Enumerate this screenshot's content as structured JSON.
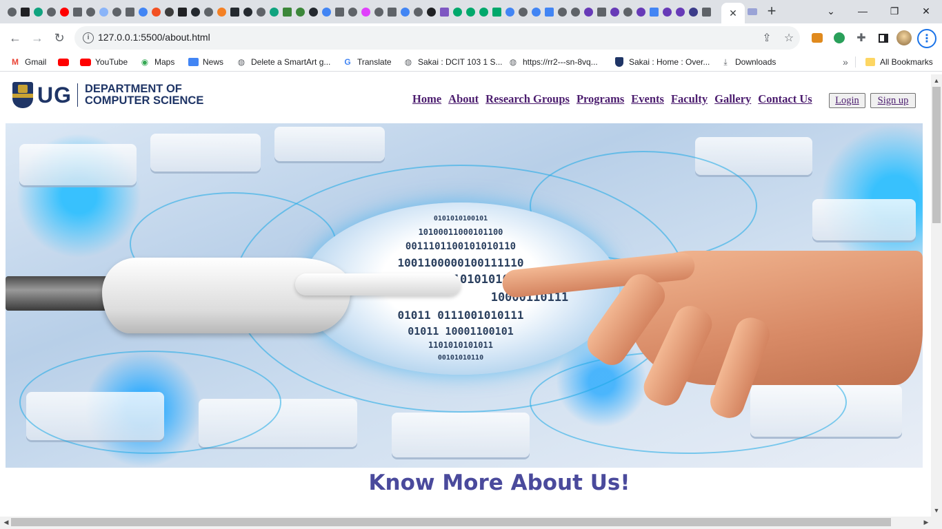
{
  "browser": {
    "url": "127.0.0.1:5500/about.html",
    "tab_close": "✕",
    "new_tab": "+",
    "window_controls": {
      "minimize": "—",
      "maximize": "❐",
      "close": "✕",
      "tab_search": "⌄"
    },
    "nav_icons": {
      "back": "←",
      "forward": "→",
      "reload": "↻"
    },
    "bookmarks": [
      {
        "label": "Gmail",
        "icon": "gmail-icon"
      },
      {
        "label": "",
        "icon": "youtube-icon"
      },
      {
        "label": "YouTube",
        "icon": "youtube-icon"
      },
      {
        "label": "Maps",
        "icon": "maps-icon"
      },
      {
        "label": "News",
        "icon": "news-icon"
      },
      {
        "label": "Delete a SmartArt g...",
        "icon": "globe-icon"
      },
      {
        "label": "Translate",
        "icon": "translate-icon"
      },
      {
        "label": "Sakai : DCIT 103 1 S...",
        "icon": "globe-icon"
      },
      {
        "label": "https://rr2---sn-8vq...",
        "icon": "globe-icon"
      },
      {
        "label": "Sakai : Home : Over...",
        "icon": "ug-crest-icon"
      },
      {
        "label": "Downloads",
        "icon": "download-icon"
      }
    ],
    "bookmarks_overflow": "»",
    "all_bookmarks": "All Bookmarks"
  },
  "site": {
    "logo_text": "UG",
    "dept_line1": "DEPARTMENT OF",
    "dept_line2": "COMPUTER SCIENCE",
    "nav": [
      "Home",
      "About",
      "Research Groups",
      "Programs",
      "Events",
      "Faculty",
      "Gallery",
      "Contact Us"
    ],
    "login_label": "Login",
    "signup_label": "Sign up",
    "hero_binary": [
      "0101010100101",
      "10100011000101100",
      "0011101100101010110",
      "1001100000100111110",
      "1010101010",
      "10000110111",
      "01011 0111001010111",
      "01011 10001100101",
      "1101010101011",
      "00101010110"
    ],
    "about_heading": "Know More About Us!"
  },
  "colors": {
    "nav_link": "#4b1c6e",
    "heading": "#4a4a9c",
    "brand_navy": "#1f3566"
  }
}
